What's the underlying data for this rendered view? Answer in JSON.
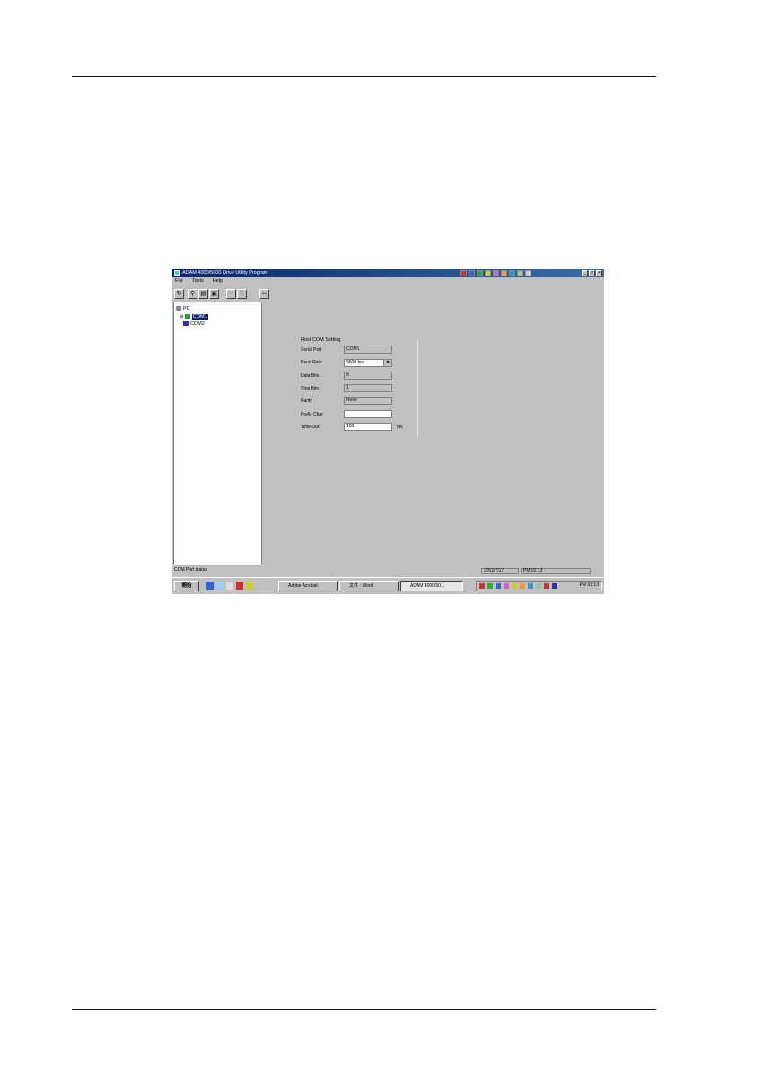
{
  "window": {
    "title": "ADAM 4000/5000 Drive Utility Program",
    "menus": [
      "File",
      "Tools",
      "Help"
    ]
  },
  "toolbar": {
    "icons": [
      "refresh-icon",
      "search-icon",
      "terminal-icon",
      "disk-icon",
      "cut-icon",
      "copy-icon",
      "exit-icon"
    ]
  },
  "tree": {
    "root": "PC",
    "items": [
      "COM1",
      "COM2"
    ]
  },
  "com_settings": {
    "group_title": "Host COM Setting",
    "fields": [
      {
        "label": "Serial Port",
        "value": "COM1"
      },
      {
        "label": "Baud Rate",
        "value": "9600 bps"
      },
      {
        "label": "Data Bits",
        "value": "8"
      },
      {
        "label": "Stop Bits",
        "value": "1"
      },
      {
        "label": "Parity",
        "value": "None"
      },
      {
        "label": "Prefix Char",
        "value": ""
      },
      {
        "label": "Time Out",
        "value": "100",
        "unit": "ms"
      }
    ]
  },
  "statusbar": {
    "left": "COM Port status",
    "date": "2002/7/17",
    "time": "PM 02:13"
  },
  "taskbar": {
    "start": "開始",
    "tasks": [
      "Adobe Acrobat",
      "文件 - Word",
      "ADAM 4000/50..."
    ],
    "clock": "PM 02:13"
  }
}
